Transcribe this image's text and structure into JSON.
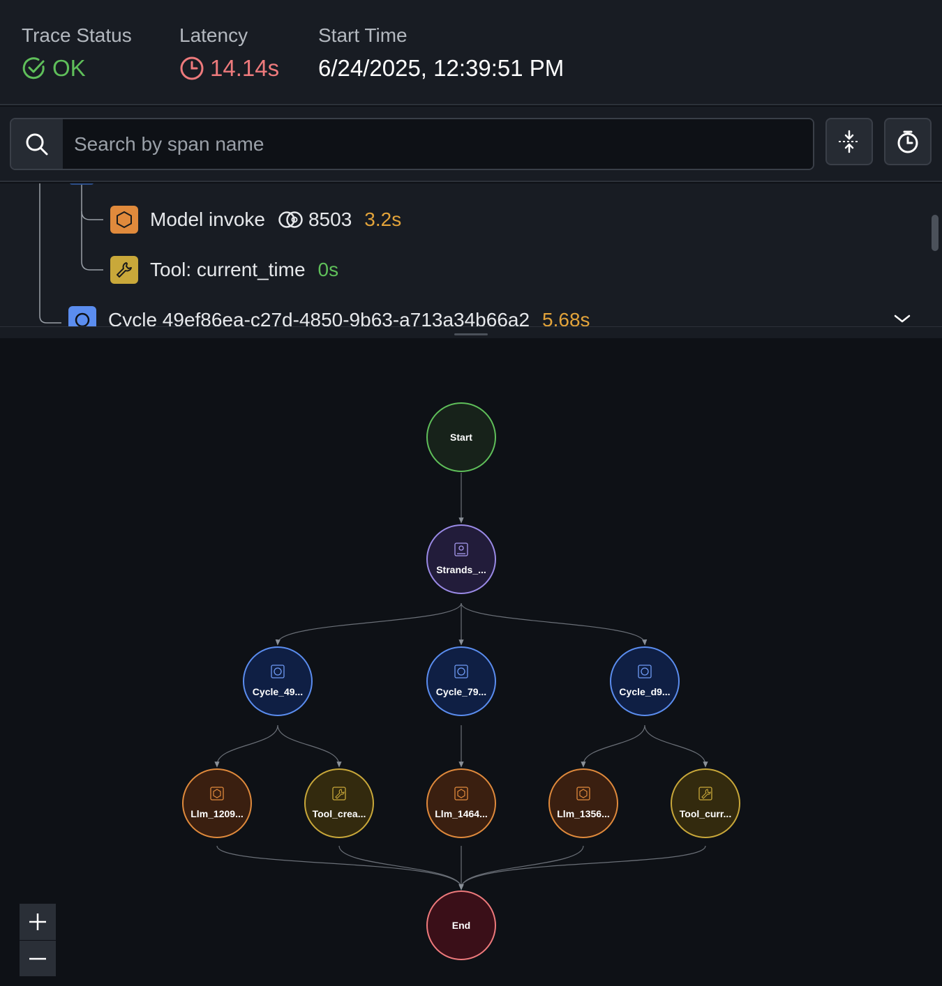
{
  "header": {
    "trace_status": {
      "label": "Trace Status",
      "value": "OK"
    },
    "latency": {
      "label": "Latency",
      "value": "14.14s"
    },
    "start_time": {
      "label": "Start Time",
      "value": "6/24/2025, 12:39:51 PM"
    }
  },
  "search": {
    "placeholder": "Search by span name"
  },
  "tree": {
    "rows": [
      {
        "icon": "hexagon-icon",
        "label": "Model invoke",
        "tokens": "8503",
        "duration": "3.2s"
      },
      {
        "icon": "wrench-icon",
        "label": "Tool: current_time",
        "duration": "0s"
      },
      {
        "icon": "cycle-icon",
        "label": "Cycle 49ef86ea-c27d-4850-9b63-a713a34b66a2",
        "duration": "5.68s"
      }
    ]
  },
  "graph": {
    "nodes": [
      {
        "label": "Start",
        "kind": "start"
      },
      {
        "label": "Strands_...",
        "kind": "agent"
      },
      {
        "label": "Cycle_49...",
        "kind": "cycle"
      },
      {
        "label": "Cycle_79...",
        "kind": "cycle"
      },
      {
        "label": "Cycle_d9...",
        "kind": "cycle"
      },
      {
        "label": "Llm_1209...",
        "kind": "llm"
      },
      {
        "label": "Tool_crea...",
        "kind": "tool"
      },
      {
        "label": "Llm_1464...",
        "kind": "llm"
      },
      {
        "label": "Llm_1356...",
        "kind": "llm"
      },
      {
        "label": "Tool_curr...",
        "kind": "tool"
      },
      {
        "label": "End",
        "kind": "end"
      }
    ]
  },
  "colors": {
    "ok": "#5fbf5a",
    "latency": "#ee7a7c",
    "duration_orange": "#e2a33a",
    "duration_green": "#5fbf5a",
    "llm_icon": "#e08a3c",
    "tool_icon": "#c9a83a",
    "cycle_icon": "#5b8def"
  },
  "zoom": {
    "in": "zoom-in",
    "out": "zoom-out"
  }
}
